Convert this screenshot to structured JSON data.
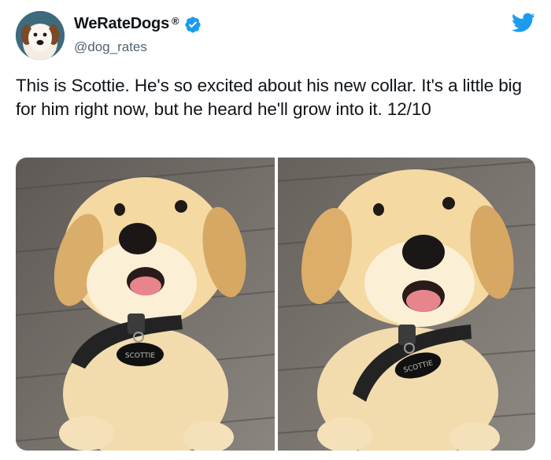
{
  "account": {
    "display_name": "WeRateDogs",
    "registered_mark": "®",
    "handle": "@dog_rates",
    "verified": true
  },
  "icons": {
    "avatar": "dog-avatar",
    "verified": "verified-badge-icon",
    "platform": "twitter-bird-icon"
  },
  "colors": {
    "brand_blue": "#1d9bf0",
    "text": "#0f1419",
    "secondary_text": "#536471"
  },
  "tweet": {
    "text": "This is Scottie. He's so excited about his new collar. It's a little big for him right now, but he heard he'll grow into it. 12/10"
  },
  "media": {
    "photos": [
      {
        "subject": "golden retriever puppy with black collar",
        "tag_text": "SCOTTIE"
      },
      {
        "subject": "golden retriever puppy with black collar",
        "tag_text": "SCOTTIE"
      }
    ]
  }
}
